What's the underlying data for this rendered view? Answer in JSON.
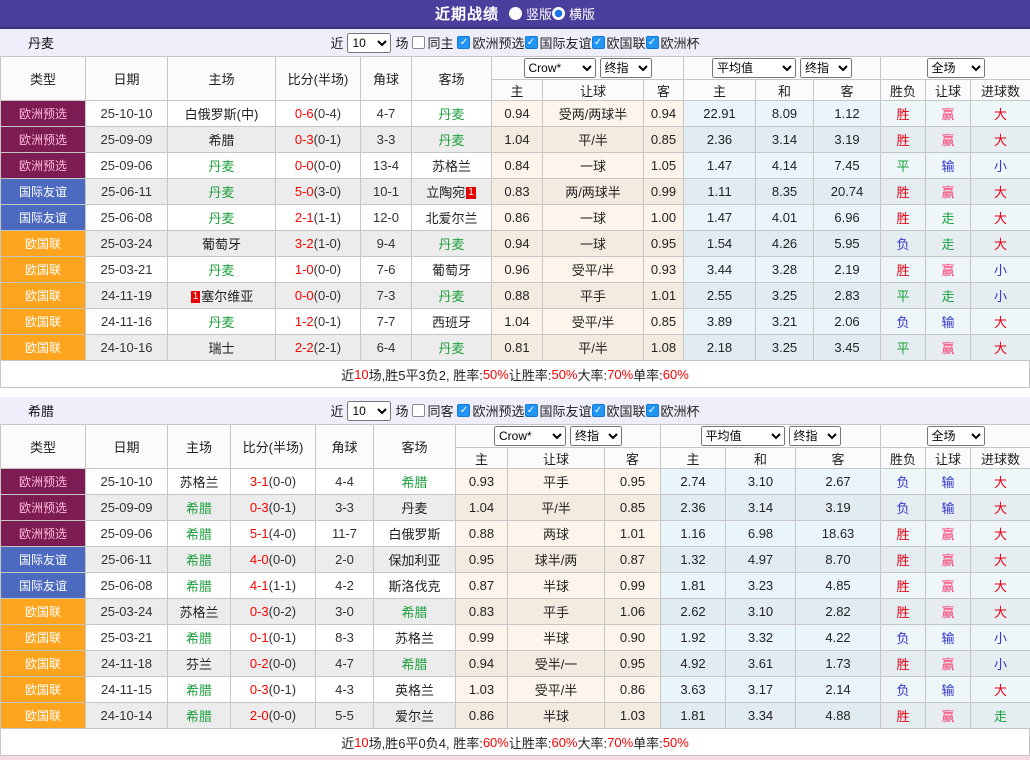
{
  "titlebar": {
    "title": "近期战绩",
    "options": [
      {
        "label": "竖版",
        "selected": false
      },
      {
        "label": "横版",
        "selected": true
      }
    ]
  },
  "controls": {
    "near": "近",
    "count": "10",
    "matches": "场",
    "comps": [
      "欧洲预选",
      "国际友谊",
      "欧国联",
      "欧洲杯"
    ]
  },
  "table_header": {
    "type": "类型",
    "date": "日期",
    "home": "主场",
    "score": "比分(半场)",
    "corner": "角球",
    "away": "客场",
    "crow": "Crow*",
    "final": "终指",
    "avg": "平均值",
    "scope": "全场",
    "sub_home": "主",
    "sub_handicap": "让球",
    "sub_away": "客",
    "sub_draw": "和",
    "wdl": "胜负",
    "handicap": "让球",
    "goals": "进球数"
  },
  "colors": {
    "topbar": "#4a3f9d",
    "type_maroon": "#7d1c52",
    "type_blue": "#4d6ac1",
    "type_orange": "#ffa41e",
    "team_green": "#1da03c",
    "score_red": "#ff0000",
    "win_red": "#e60012",
    "win_pink": "#fc3d72",
    "lose_indigo": "#3136c9",
    "draw_green": "#17a23c"
  },
  "type_colors": {
    "欧洲预选": "maroon",
    "国际友谊": "blue",
    "欧国联": "orange"
  },
  "result_colors": {
    "胜": "red",
    "平": "green",
    "负": "indigo",
    "赢": "pink",
    "输": "indigo",
    "走": "green",
    "大": "red",
    "小": "indigo"
  },
  "sections": [
    {
      "team": "丹麦",
      "same_label": "同主",
      "rows": [
        {
          "comp": "欧洲预选",
          "date": "25-10-10",
          "home": "白俄罗斯(中)",
          "home_is_team": false,
          "score_ft": "0-6",
          "score_ht": "(0-4)",
          "corner": "4-7",
          "away": "丹麦",
          "away_is_team": true,
          "crow_home": "0.94",
          "crow_handicap": "受两/两球半",
          "crow_away": "0.94",
          "avg_home": "22.91",
          "avg_draw": "8.09",
          "avg_away": "1.12",
          "res_wdl": "胜",
          "res_handicap": "赢",
          "res_goals": "大"
        },
        {
          "comp": "欧洲预选",
          "date": "25-09-09",
          "home": "希腊",
          "home_is_team": false,
          "score_ft": "0-3",
          "score_ht": "(0-1)",
          "corner": "3-3",
          "away": "丹麦",
          "away_is_team": true,
          "crow_home": "1.04",
          "crow_handicap": "平/半",
          "crow_away": "0.85",
          "avg_home": "2.36",
          "avg_draw": "3.14",
          "avg_away": "3.19",
          "res_wdl": "胜",
          "res_handicap": "赢",
          "res_goals": "大"
        },
        {
          "comp": "欧洲预选",
          "date": "25-09-06",
          "home": "丹麦",
          "home_is_team": true,
          "score_ft": "0-0",
          "score_ht": "(0-0)",
          "corner": "13-4",
          "away": "苏格兰",
          "away_is_team": false,
          "crow_home": "0.84",
          "crow_handicap": "一球",
          "crow_away": "1.05",
          "avg_home": "1.47",
          "avg_draw": "4.14",
          "avg_away": "7.45",
          "res_wdl": "平",
          "res_handicap": "输",
          "res_goals": "小"
        },
        {
          "comp": "国际友谊",
          "date": "25-06-11",
          "home": "丹麦",
          "home_is_team": true,
          "score_ft": "5-0",
          "score_ht": "(3-0)",
          "corner": "10-1",
          "away": "立陶宛",
          "away_is_team": false,
          "away_badge": {
            "text": "1",
            "pos": "after"
          },
          "crow_home": "0.83",
          "crow_handicap": "两/两球半",
          "crow_away": "0.99",
          "avg_home": "1.11",
          "avg_draw": "8.35",
          "avg_away": "20.74",
          "res_wdl": "胜",
          "res_handicap": "赢",
          "res_goals": "大"
        },
        {
          "comp": "国际友谊",
          "date": "25-06-08",
          "home": "丹麦",
          "home_is_team": true,
          "score_ft": "2-1",
          "score_ht": "(1-1)",
          "corner": "12-0",
          "away": "北爱尔兰",
          "away_is_team": false,
          "crow_home": "0.86",
          "crow_handicap": "一球",
          "crow_away": "1.00",
          "avg_home": "1.47",
          "avg_draw": "4.01",
          "avg_away": "6.96",
          "res_wdl": "胜",
          "res_handicap": "走",
          "res_goals": "大"
        },
        {
          "comp": "欧国联",
          "date": "25-03-24",
          "home": "葡萄牙",
          "home_is_team": false,
          "score_ft": "3-2",
          "score_ht": "(1-0)",
          "corner": "9-4",
          "away": "丹麦",
          "away_is_team": true,
          "crow_home": "0.94",
          "crow_handicap": "一球",
          "crow_away": "0.95",
          "avg_home": "1.54",
          "avg_draw": "4.26",
          "avg_away": "5.95",
          "res_wdl": "负",
          "res_handicap": "走",
          "res_goals": "大"
        },
        {
          "comp": "欧国联",
          "date": "25-03-21",
          "home": "丹麦",
          "home_is_team": true,
          "score_ft": "1-0",
          "score_ht": "(0-0)",
          "corner": "7-6",
          "away": "葡萄牙",
          "away_is_team": false,
          "crow_home": "0.96",
          "crow_handicap": "受平/半",
          "crow_away": "0.93",
          "avg_home": "3.44",
          "avg_draw": "3.28",
          "avg_away": "2.19",
          "res_wdl": "胜",
          "res_handicap": "赢",
          "res_goals": "小"
        },
        {
          "comp": "欧国联",
          "date": "24-11-19",
          "home": "塞尔维亚",
          "home_is_team": false,
          "home_badge": {
            "text": "1",
            "pos": "before"
          },
          "score_ft": "0-0",
          "score_ht": "(0-0)",
          "corner": "7-3",
          "away": "丹麦",
          "away_is_team": true,
          "crow_home": "0.88",
          "crow_handicap": "平手",
          "crow_away": "1.01",
          "avg_home": "2.55",
          "avg_draw": "3.25",
          "avg_away": "2.83",
          "res_wdl": "平",
          "res_handicap": "走",
          "res_goals": "小"
        },
        {
          "comp": "欧国联",
          "date": "24-11-16",
          "home": "丹麦",
          "home_is_team": true,
          "score_ft": "1-2",
          "score_ht": "(0-1)",
          "corner": "7-7",
          "away": "西班牙",
          "away_is_team": false,
          "crow_home": "1.04",
          "crow_handicap": "受平/半",
          "crow_away": "0.85",
          "avg_home": "3.89",
          "avg_draw": "3.21",
          "avg_away": "2.06",
          "res_wdl": "负",
          "res_handicap": "输",
          "res_goals": "大"
        },
        {
          "comp": "欧国联",
          "date": "24-10-16",
          "home": "瑞士",
          "home_is_team": false,
          "score_ft": "2-2",
          "score_ht": "(2-1)",
          "corner": "6-4",
          "away": "丹麦",
          "away_is_team": true,
          "crow_home": "0.81",
          "crow_handicap": "平/半",
          "crow_away": "1.08",
          "avg_home": "2.18",
          "avg_draw": "3.25",
          "avg_away": "3.45",
          "res_wdl": "平",
          "res_handicap": "赢",
          "res_goals": "大"
        }
      ],
      "summary": [
        [
          "近",
          false
        ],
        [
          "10",
          true
        ],
        [
          "场,胜5平3负2, 胜率:",
          false
        ],
        [
          "50%",
          true
        ],
        [
          " 让胜率:",
          false
        ],
        [
          "50%",
          true
        ],
        [
          " 大率:",
          false
        ],
        [
          "70%",
          true
        ],
        [
          " 单率:",
          false
        ],
        [
          "60%",
          true
        ]
      ]
    },
    {
      "team": "希腊",
      "same_label": "同客",
      "rows": [
        {
          "comp": "欧洲预选",
          "date": "25-10-10",
          "home": "苏格兰",
          "home_is_team": false,
          "score_ft": "3-1",
          "score_ht": "(0-0)",
          "corner": "4-4",
          "away": "希腊",
          "away_is_team": true,
          "crow_home": "0.93",
          "crow_handicap": "平手",
          "crow_away": "0.95",
          "avg_home": "2.74",
          "avg_draw": "3.10",
          "avg_away": "2.67",
          "res_wdl": "负",
          "res_handicap": "输",
          "res_goals": "大"
        },
        {
          "comp": "欧洲预选",
          "date": "25-09-09",
          "home": "希腊",
          "home_is_team": true,
          "score_ft": "0-3",
          "score_ht": "(0-1)",
          "corner": "3-3",
          "away": "丹麦",
          "away_is_team": false,
          "crow_home": "1.04",
          "crow_handicap": "平/半",
          "crow_away": "0.85",
          "avg_home": "2.36",
          "avg_draw": "3.14",
          "avg_away": "3.19",
          "res_wdl": "负",
          "res_handicap": "输",
          "res_goals": "大"
        },
        {
          "comp": "欧洲预选",
          "date": "25-09-06",
          "home": "希腊",
          "home_is_team": true,
          "score_ft": "5-1",
          "score_ht": "(4-0)",
          "corner": "11-7",
          "away": "白俄罗斯",
          "away_is_team": false,
          "crow_home": "0.88",
          "crow_handicap": "两球",
          "crow_away": "1.01",
          "avg_home": "1.16",
          "avg_draw": "6.98",
          "avg_away": "18.63",
          "res_wdl": "胜",
          "res_handicap": "赢",
          "res_goals": "大"
        },
        {
          "comp": "国际友谊",
          "date": "25-06-11",
          "home": "希腊",
          "home_is_team": true,
          "score_ft": "4-0",
          "score_ht": "(0-0)",
          "corner": "2-0",
          "away": "保加利亚",
          "away_is_team": false,
          "crow_home": "0.95",
          "crow_handicap": "球半/两",
          "crow_away": "0.87",
          "avg_home": "1.32",
          "avg_draw": "4.97",
          "avg_away": "8.70",
          "res_wdl": "胜",
          "res_handicap": "赢",
          "res_goals": "大"
        },
        {
          "comp": "国际友谊",
          "date": "25-06-08",
          "home": "希腊",
          "home_is_team": true,
          "score_ft": "4-1",
          "score_ht": "(1-1)",
          "corner": "4-2",
          "away": "斯洛伐克",
          "away_is_team": false,
          "crow_home": "0.87",
          "crow_handicap": "半球",
          "crow_away": "0.99",
          "avg_home": "1.81",
          "avg_draw": "3.23",
          "avg_away": "4.85",
          "res_wdl": "胜",
          "res_handicap": "赢",
          "res_goals": "大"
        },
        {
          "comp": "欧国联",
          "date": "25-03-24",
          "home": "苏格兰",
          "home_is_team": false,
          "score_ft": "0-3",
          "score_ht": "(0-2)",
          "corner": "3-0",
          "away": "希腊",
          "away_is_team": true,
          "crow_home": "0.83",
          "crow_handicap": "平手",
          "crow_away": "1.06",
          "avg_home": "2.62",
          "avg_draw": "3.10",
          "avg_away": "2.82",
          "res_wdl": "胜",
          "res_handicap": "赢",
          "res_goals": "大"
        },
        {
          "comp": "欧国联",
          "date": "25-03-21",
          "home": "希腊",
          "home_is_team": true,
          "score_ft": "0-1",
          "score_ht": "(0-1)",
          "corner": "8-3",
          "away": "苏格兰",
          "away_is_team": false,
          "crow_home": "0.99",
          "crow_handicap": "半球",
          "crow_away": "0.90",
          "avg_home": "1.92",
          "avg_draw": "3.32",
          "avg_away": "4.22",
          "res_wdl": "负",
          "res_handicap": "输",
          "res_goals": "小"
        },
        {
          "comp": "欧国联",
          "date": "24-11-18",
          "home": "芬兰",
          "home_is_team": false,
          "score_ft": "0-2",
          "score_ht": "(0-0)",
          "corner": "4-7",
          "away": "希腊",
          "away_is_team": true,
          "crow_home": "0.94",
          "crow_handicap": "受半/一",
          "crow_away": "0.95",
          "avg_home": "4.92",
          "avg_draw": "3.61",
          "avg_away": "1.73",
          "res_wdl": "胜",
          "res_handicap": "赢",
          "res_goals": "小"
        },
        {
          "comp": "欧国联",
          "date": "24-11-15",
          "home": "希腊",
          "home_is_team": true,
          "score_ft": "0-3",
          "score_ht": "(0-1)",
          "corner": "4-3",
          "away": "英格兰",
          "away_is_team": false,
          "crow_home": "1.03",
          "crow_handicap": "受平/半",
          "crow_away": "0.86",
          "avg_home": "3.63",
          "avg_draw": "3.17",
          "avg_away": "2.14",
          "res_wdl": "负",
          "res_handicap": "输",
          "res_goals": "大"
        },
        {
          "comp": "欧国联",
          "date": "24-10-14",
          "home": "希腊",
          "home_is_team": true,
          "score_ft": "2-0",
          "score_ht": "(0-0)",
          "corner": "5-5",
          "away": "爱尔兰",
          "away_is_team": false,
          "crow_home": "0.86",
          "crow_handicap": "半球",
          "crow_away": "1.03",
          "avg_home": "1.81",
          "avg_draw": "3.34",
          "avg_away": "4.88",
          "res_wdl": "胜",
          "res_handicap": "赢",
          "res_goals": "走"
        }
      ],
      "summary": [
        [
          "近",
          false
        ],
        [
          "10",
          true
        ],
        [
          "场,胜6平0负4, 胜率:",
          false
        ],
        [
          "60%",
          true
        ],
        [
          " 让胜率:",
          false
        ],
        [
          "60%",
          true
        ],
        [
          " 大率:",
          false
        ],
        [
          "70%",
          true
        ],
        [
          " 单率:",
          false
        ],
        [
          "50%",
          true
        ]
      ]
    }
  ]
}
